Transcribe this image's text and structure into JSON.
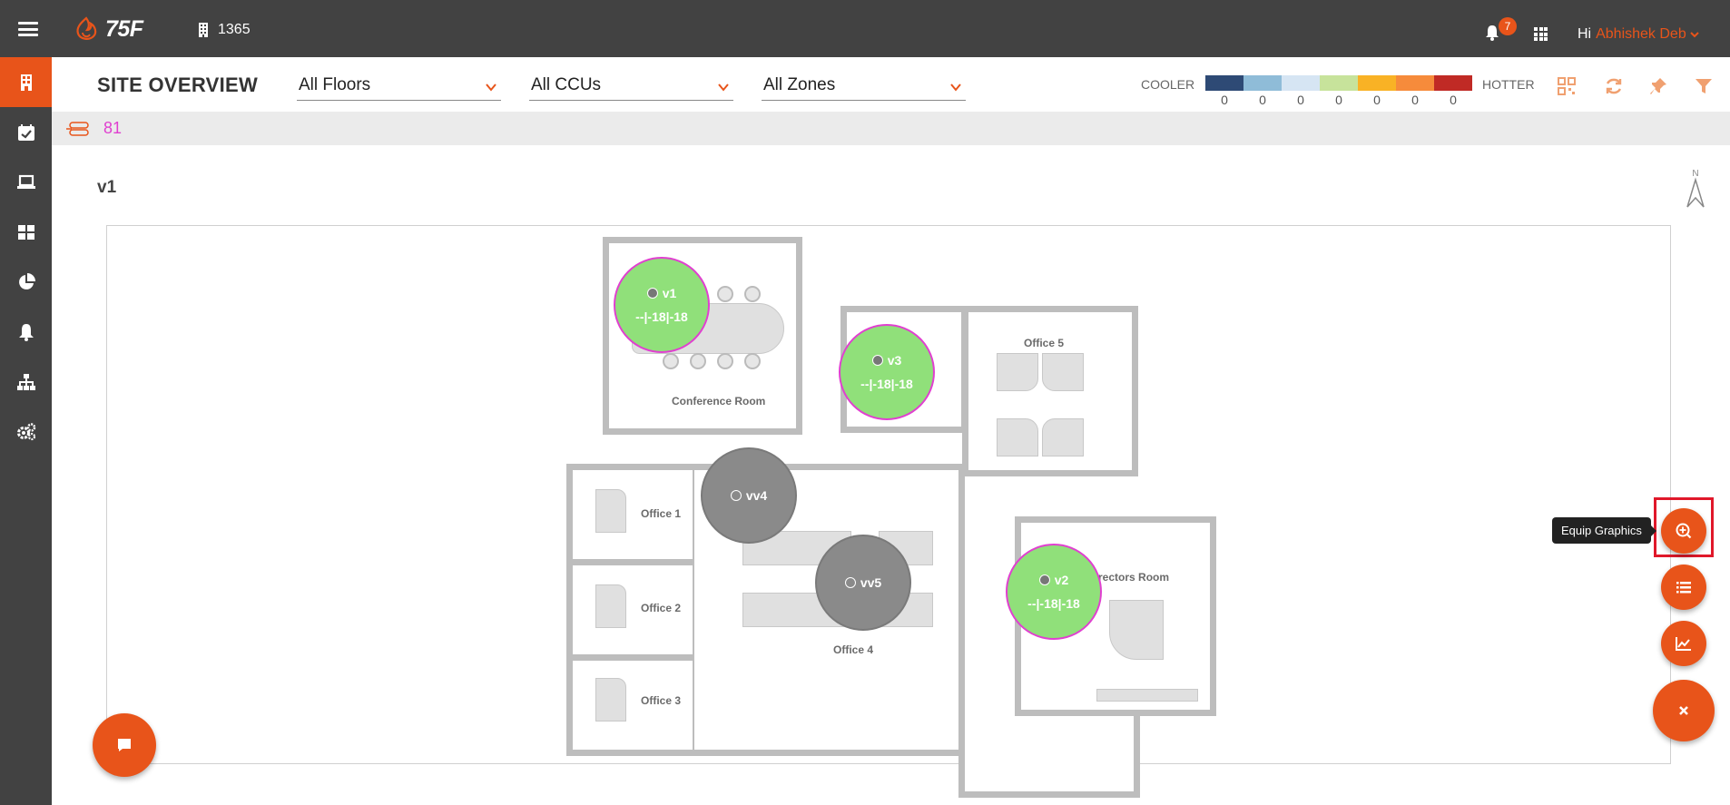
{
  "topbar": {
    "logo_text": "75F",
    "site_id": "1365",
    "notification_count": "7",
    "greeting": "Hi",
    "user_name": "Abhishek Deb"
  },
  "sidebar": {
    "items": [
      {
        "name": "site-overview",
        "icon": "building-icon",
        "active": true
      },
      {
        "name": "schedules",
        "icon": "calendar-check-icon"
      },
      {
        "name": "devices",
        "icon": "laptop-icon"
      },
      {
        "name": "dashboard",
        "icon": "grid-icon"
      },
      {
        "name": "reports",
        "icon": "pie-chart-icon"
      },
      {
        "name": "alerts",
        "icon": "bell-icon"
      },
      {
        "name": "hierarchy",
        "icon": "sitemap-icon"
      },
      {
        "name": "settings",
        "icon": "gears-icon"
      }
    ]
  },
  "header": {
    "title": "SITE OVERVIEW",
    "floors_select": "All Floors",
    "ccus_select": "All CCUs",
    "zones_select": "All Zones",
    "legend": {
      "cooler_label": "COOLER",
      "hotter_label": "HOTTER",
      "colors": [
        "#2e4a75",
        "#8fbcd8",
        "#d6e5f3",
        "#c7e39b",
        "#f9b225",
        "#f68b3b",
        "#c02a25"
      ],
      "counts": [
        "0",
        "0",
        "0",
        "0",
        "0",
        "0",
        "0"
      ]
    }
  },
  "strip": {
    "count": "81"
  },
  "floor": {
    "name": "v1",
    "compass_label": "N",
    "rooms": {
      "conference": "Conference Room",
      "office5": "Office 5",
      "office1": "Office 1",
      "office2": "Office 2",
      "office3": "Office 3",
      "office4": "Office 4",
      "directors": "Directors Room"
    },
    "zones": [
      {
        "name": "v1",
        "temp": "--|-18|-18",
        "active": true
      },
      {
        "name": "v3",
        "temp": "--|-18|-18",
        "active": true
      },
      {
        "name": "vv4",
        "temp": "",
        "active": false
      },
      {
        "name": "vv5",
        "temp": "",
        "active": false
      },
      {
        "name": "v2",
        "temp": "--|-18|-18",
        "active": true
      }
    ]
  },
  "fabs": {
    "equip_tooltip": "Equip Graphics"
  }
}
